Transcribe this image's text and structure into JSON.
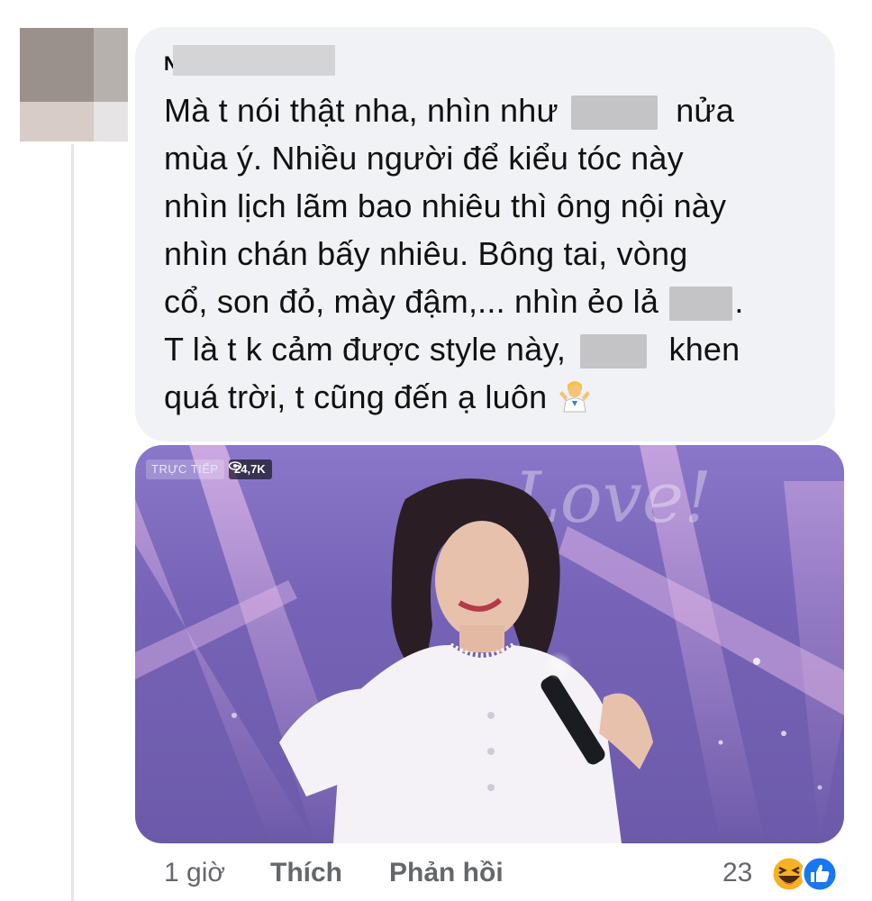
{
  "comment": {
    "author_initial": "N",
    "lines": [
      [
        "Mà t nói thật nha, nhìn như ",
        "",
        " nửa"
      ],
      [
        "mùa ý. Nhiều người để kiểu tóc này"
      ],
      [
        "nhìn lịch lãm bao nhiêu thì ông nội này"
      ],
      [
        "nhìn chán bấy nhiêu. Bông tai, vòng"
      ],
      [
        "cổ, son đỏ, mày đậm,... nhìn ẻo lả ",
        "",
        "."
      ],
      [
        "T là t k cảm được style này, ",
        "",
        " khen"
      ],
      [
        "quá trời, t cũng đến ạ luôn"
      ]
    ],
    "emoji": "person-shrugging-emoji"
  },
  "photo": {
    "live_label": "TRỰC TIẾP",
    "viewers": "24,7K",
    "overlay_text": "Love!"
  },
  "actions": {
    "time": "1 giờ",
    "like": "Thích",
    "reply": "Phản hồi",
    "reaction_count": "23",
    "reaction_icons": [
      "haha-reaction-icon",
      "like-reaction-icon"
    ]
  },
  "colors": {
    "bubble": "#f0f2f5",
    "meta_text": "#65676b",
    "like_blue": "#1877f2",
    "haha_yellow": "#f7b125"
  }
}
